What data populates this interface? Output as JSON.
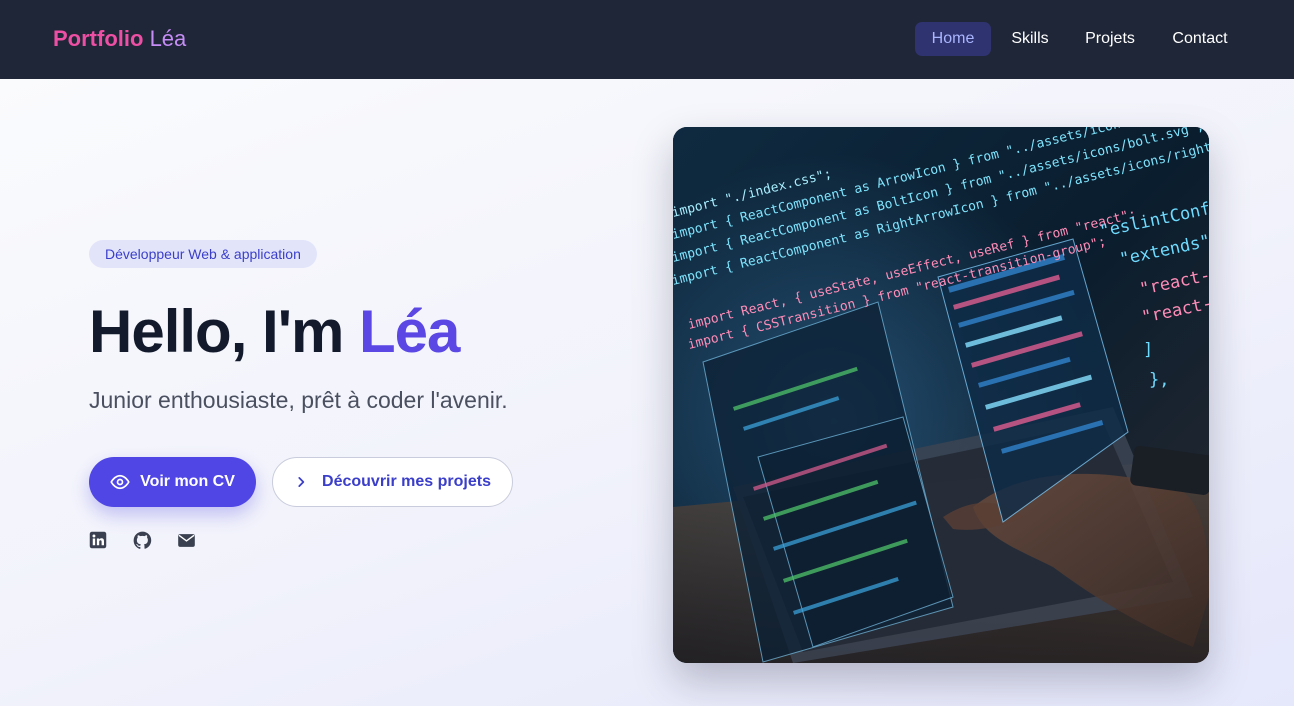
{
  "nav": {
    "brand_main": "Portfolio",
    "brand_name": "Léa",
    "links": [
      {
        "label": "Home",
        "active": true
      },
      {
        "label": "Skills",
        "active": false
      },
      {
        "label": "Projets",
        "active": false
      },
      {
        "label": "Contact",
        "active": false
      }
    ]
  },
  "hero": {
    "badge": "Développeur Web & application",
    "headline_prefix": "Hello, I'm",
    "headline_name": "Léa",
    "tagline": "Junior enthousiaste, prêt à coder l'avenir.",
    "primary_button": {
      "label": "Voir mon CV",
      "icon": "eye-icon"
    },
    "secondary_button": {
      "label": "Découvrir mes projets",
      "icon": "chevron-right-icon"
    },
    "socials": [
      {
        "icon": "linkedin-icon"
      },
      {
        "icon": "github-icon"
      },
      {
        "icon": "mail-icon"
      }
    ]
  },
  "image": {
    "code_lines": [
      "import \"./index.css\";",
      "import { ReactComponent as ArrowIcon } from \"../assets/icons/arrow.svg\";",
      "import { ReactComponent as BoltIcon } from \"../assets/icons/bolt.svg\";",
      "import { ReactComponent as RightArrowIcon } from \"../assets/icons/right-arrow.svg\";",
      "import React, { useState, useEffect, useRef } from \"react\";",
      "import { CSSTransition } from \"react-transition-group\";"
    ],
    "config_lines": [
      "\"eslintConfig\": {",
      "\"extends\": [",
      "\"react-app\",",
      "\"react-app",
      "]",
      "},"
    ]
  },
  "colors": {
    "nav_bg": "#1f2637",
    "brand_pink": "#ec4fa3",
    "brand_violet": "#c58df5",
    "accent": "#4f46e5",
    "heading": "#131a2b"
  }
}
